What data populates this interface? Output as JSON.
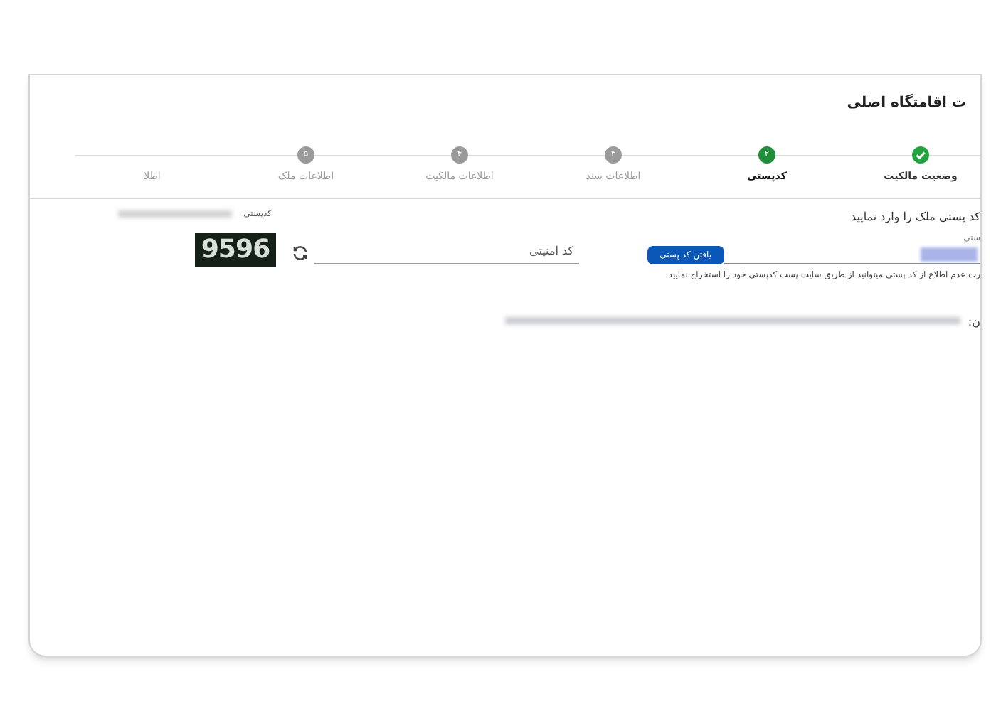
{
  "page": {
    "title": "ت اقامتگاه اصلی"
  },
  "steps": [
    {
      "label": "وضعیت مالکیت",
      "done": true,
      "selected": false
    },
    {
      "label": "کدپستی",
      "number": "۲",
      "done": false,
      "selected": true
    },
    {
      "label": "اطلاعات سند",
      "number": "۳",
      "done": false,
      "selected": false
    },
    {
      "label": "اطلاعات مالکیت",
      "number": "۴",
      "done": false,
      "selected": false
    },
    {
      "label": "اطلاعات ملک",
      "number": "۵",
      "done": false,
      "selected": false
    },
    {
      "label": "اطلا",
      "done": false,
      "selected": false
    }
  ],
  "form": {
    "summary_label": "کدپستی",
    "instruction": "کد پستی ملک را وارد نمایید",
    "postal_field_label": "ستی",
    "find_button": "یافتن کد پستی",
    "help": "رت عدم اطلاع از کد پستی میتوانید از طریق سایت پست کدپستی خود را استخراج نمایید",
    "security_placeholder": "کد امنیتی",
    "captcha": "9596",
    "result_label": "ن:"
  }
}
